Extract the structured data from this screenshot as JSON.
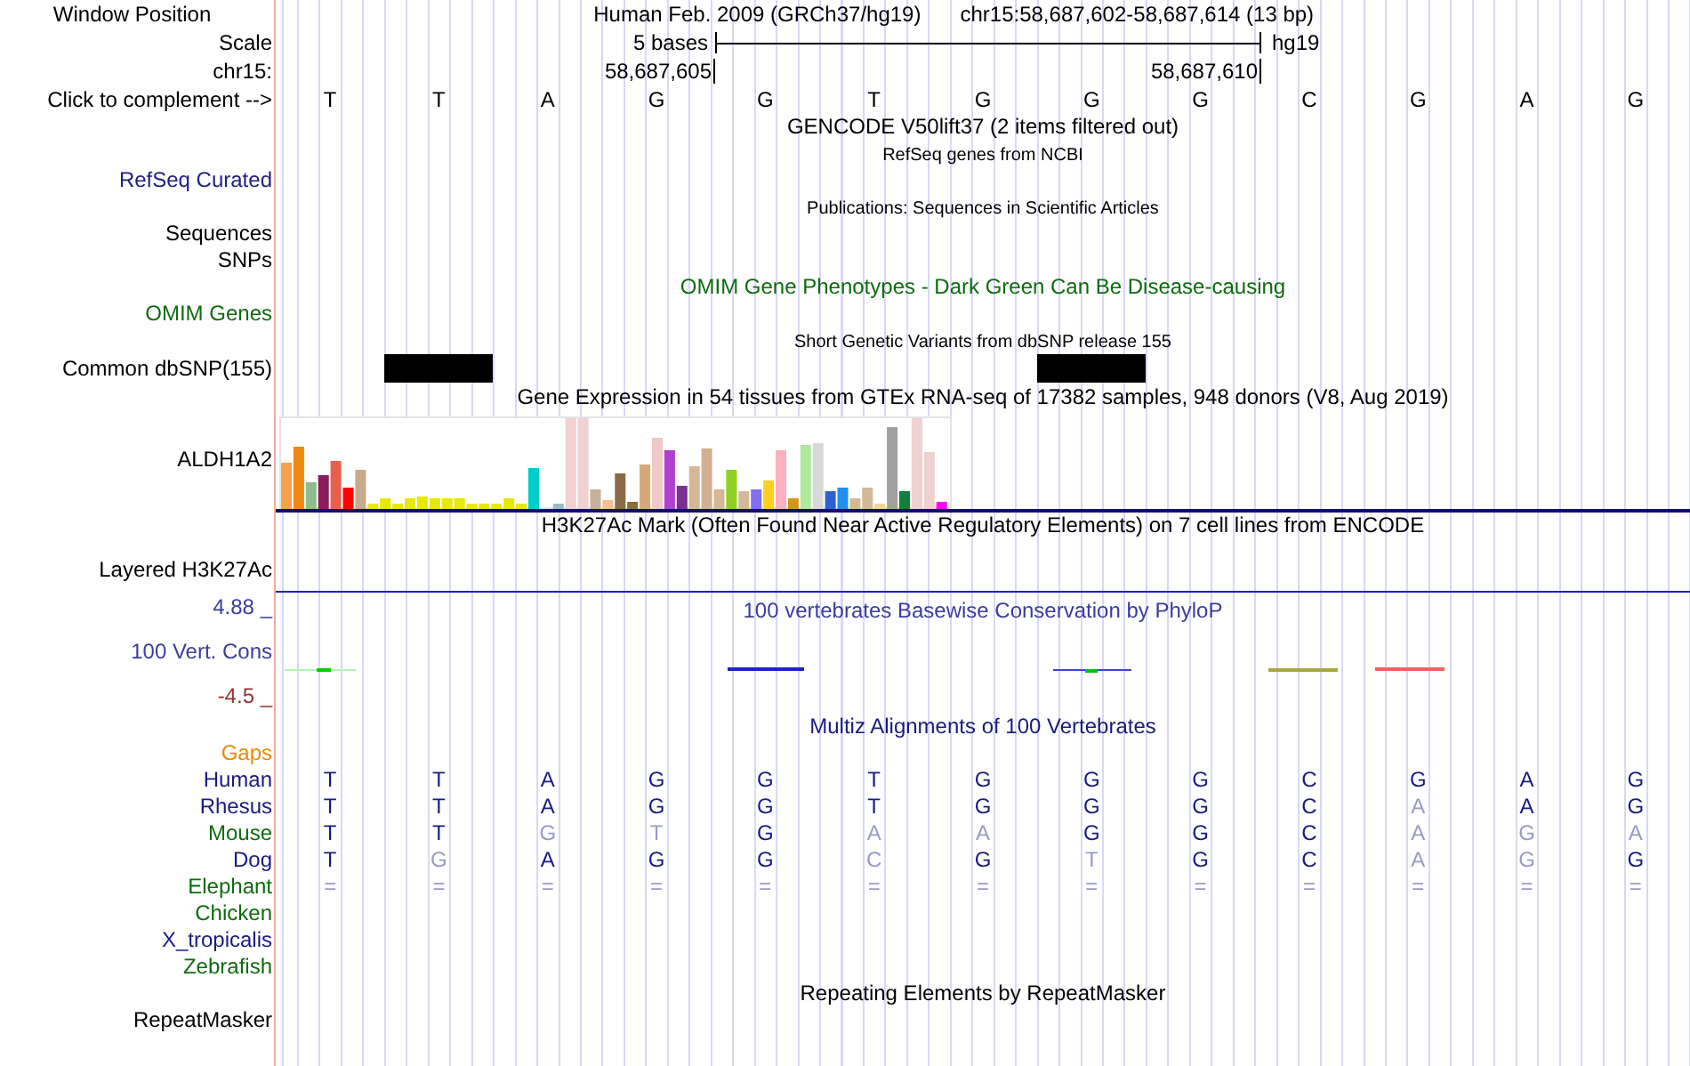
{
  "header": {
    "label": "Window Position",
    "assembly": "Human Feb. 2009 (GRCh37/hg19)",
    "position": "chr15:58,687,602-58,687,614 (13 bp)"
  },
  "scale": {
    "label": "Scale",
    "text": "5 bases",
    "assembly": "hg19"
  },
  "coordinates": {
    "label": "chr15:",
    "start": "58,687,605",
    "end": "58,687,610"
  },
  "sequence": {
    "label": "Click to complement -->",
    "bases": [
      "T",
      "T",
      "A",
      "G",
      "G",
      "T",
      "G",
      "G",
      "G",
      "C",
      "G",
      "A",
      "G"
    ]
  },
  "rows": [
    {
      "kind": "title",
      "text": "GENCODE V50lift37 (2 items filtered out)",
      "color": "#000000"
    },
    {
      "kind": "subtitle",
      "text": "RefSeq genes from NCBI",
      "color": "#000000"
    },
    {
      "kind": "label",
      "label": "RefSeq Curated",
      "color": "#202080"
    },
    {
      "kind": "subtitle",
      "text": "Publications: Sequences in Scientific Articles",
      "color": "#000000"
    },
    {
      "kind": "label",
      "label": "Sequences",
      "color": "#000000"
    },
    {
      "kind": "label",
      "label": "SNPs",
      "color": "#000000"
    },
    {
      "kind": "title",
      "text": "OMIM Gene Phenotypes - Dark Green Can Be Disease-causing",
      "color": "#0d6b0d"
    },
    {
      "kind": "label",
      "label": "OMIM Genes",
      "color": "#0d6b0d"
    },
    {
      "kind": "subtitle",
      "text": "Short Genetic Variants from dbSNP release 155",
      "color": "#000000"
    },
    {
      "kind": "snp",
      "label": "Common dbSNP(155)",
      "color": "#000000",
      "present": [
        false,
        true,
        false,
        false,
        false,
        false,
        false,
        true,
        false,
        false,
        false,
        false,
        false
      ]
    },
    {
      "kind": "title",
      "text": "Gene Expression in 54 tissues from GTEx RNA-seq of 17382 samples, 948 donors (V8, Aug 2019)",
      "color": "#000000"
    },
    {
      "kind": "gtex",
      "label": "ALDH1A2",
      "color": "#000000"
    },
    {
      "kind": "title",
      "text": "H3K27Ac Mark (Often Found Near Active Regulatory Elements) on 7 cell lines from ENCODE",
      "color": "#000000"
    },
    {
      "kind": "layered",
      "label": "Layered H3K27Ac",
      "color": "#000000"
    },
    {
      "kind": "phylop",
      "title": "100 vertebrates Basewise Conservation by PhyloP",
      "label": "100 Vert. Cons",
      "max": "4.88 _",
      "min": "-4.5 _",
      "color": "#3c3c9c"
    },
    {
      "kind": "title",
      "text": "Multiz Alignments of 100 Vertebrates",
      "color": "#1a1a80"
    },
    {
      "kind": "label",
      "label": "Gaps",
      "color": "#e8890c"
    },
    {
      "kind": "alignment",
      "label": "Human",
      "color": "#1a1a80",
      "bases": [
        {
          "base": "T",
          "match": true
        },
        {
          "base": "T",
          "match": true
        },
        {
          "base": "A",
          "match": true
        },
        {
          "base": "G",
          "match": true
        },
        {
          "base": "G",
          "match": true
        },
        {
          "base": "T",
          "match": true
        },
        {
          "base": "G",
          "match": true
        },
        {
          "base": "G",
          "match": true
        },
        {
          "base": "G",
          "match": true
        },
        {
          "base": "C",
          "match": true
        },
        {
          "base": "G",
          "match": true
        },
        {
          "base": "A",
          "match": true
        },
        {
          "base": "G",
          "match": true
        }
      ]
    },
    {
      "kind": "alignment",
      "label": "Rhesus",
      "color": "#1a1a80",
      "bases": [
        {
          "base": "T",
          "match": true
        },
        {
          "base": "T",
          "match": true
        },
        {
          "base": "A",
          "match": true
        },
        {
          "base": "G",
          "match": true
        },
        {
          "base": "G",
          "match": true
        },
        {
          "base": "T",
          "match": true
        },
        {
          "base": "G",
          "match": true
        },
        {
          "base": "G",
          "match": true
        },
        {
          "base": "G",
          "match": true
        },
        {
          "base": "C",
          "match": true
        },
        {
          "base": "A",
          "match": false
        },
        {
          "base": "A",
          "match": true
        },
        {
          "base": "G",
          "match": true
        }
      ]
    },
    {
      "kind": "alignment",
      "label": "Mouse",
      "color": "#0d6b0d",
      "bases": [
        {
          "base": "T",
          "match": true
        },
        {
          "base": "T",
          "match": true
        },
        {
          "base": "G",
          "match": false
        },
        {
          "base": "T",
          "match": false
        },
        {
          "base": "G",
          "match": true
        },
        {
          "base": "A",
          "match": false
        },
        {
          "base": "A",
          "match": false
        },
        {
          "base": "G",
          "match": true
        },
        {
          "base": "G",
          "match": true
        },
        {
          "base": "C",
          "match": true
        },
        {
          "base": "A",
          "match": false
        },
        {
          "base": "G",
          "match": false
        },
        {
          "base": "A",
          "match": false
        }
      ]
    },
    {
      "kind": "alignment",
      "label": "Dog",
      "color": "#1a1a80",
      "bases": [
        {
          "base": "T",
          "match": true
        },
        {
          "base": "G",
          "match": false
        },
        {
          "base": "A",
          "match": true
        },
        {
          "base": "G",
          "match": true
        },
        {
          "base": "G",
          "match": true
        },
        {
          "base": "C",
          "match": false
        },
        {
          "base": "G",
          "match": true
        },
        {
          "base": "T",
          "match": false
        },
        {
          "base": "G",
          "match": true
        },
        {
          "base": "C",
          "match": true
        },
        {
          "base": "A",
          "match": false
        },
        {
          "base": "G",
          "match": false
        },
        {
          "base": "G",
          "match": true
        }
      ]
    },
    {
      "kind": "alignment",
      "label": "Elephant",
      "color": "#0d6b0d",
      "bases": [
        {
          "base": "=",
          "match": false
        },
        {
          "base": "=",
          "match": false
        },
        {
          "base": "=",
          "match": false
        },
        {
          "base": "=",
          "match": false
        },
        {
          "base": "=",
          "match": false
        },
        {
          "base": "=",
          "match": false
        },
        {
          "base": "=",
          "match": false
        },
        {
          "base": "=",
          "match": false
        },
        {
          "base": "=",
          "match": false
        },
        {
          "base": "=",
          "match": false
        },
        {
          "base": "=",
          "match": false
        },
        {
          "base": "=",
          "match": false
        },
        {
          "base": "=",
          "match": false
        }
      ]
    },
    {
      "kind": "label",
      "label": "Chicken",
      "color": "#0d6b0d"
    },
    {
      "kind": "label",
      "label": "X_tropicalis",
      "color": "#1a1a80"
    },
    {
      "kind": "label",
      "label": "Zebrafish",
      "color": "#0d6b0d"
    },
    {
      "kind": "title",
      "text": "Repeating Elements by RepeatMasker",
      "color": "#000000"
    },
    {
      "kind": "label",
      "label": "RepeatMasker",
      "color": "#000000"
    }
  ]
}
